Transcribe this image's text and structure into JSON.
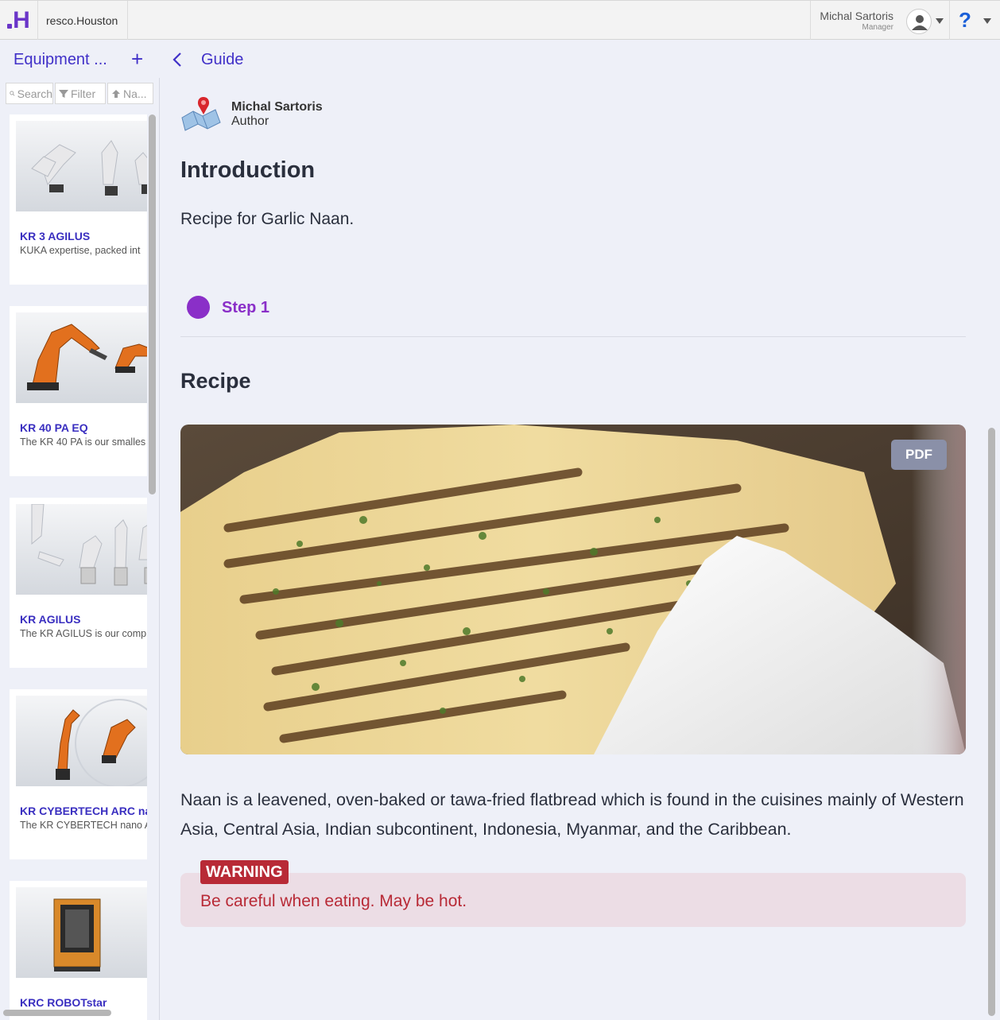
{
  "app": {
    "org": "resco.Houston",
    "colors": {
      "accent": "#4030c8",
      "logo": "#6a35c8",
      "step": "#8a2fc8",
      "warning": "#b82a36"
    }
  },
  "user": {
    "name": "Michal Sartoris",
    "role": "Manager",
    "help": "?"
  },
  "nav": {
    "title": "Equipment ...",
    "plus": "+",
    "guide": "Guide"
  },
  "sidebar": {
    "search_placeholder": "Search",
    "filter_label": "Filter",
    "sort_label": "Na...",
    "items": [
      {
        "title": "KR 3 AGILUS",
        "desc": "KUKA expertise, packed int"
      },
      {
        "title": "KR 40 PA EQ",
        "desc": "The KR 40 PA is our smalles"
      },
      {
        "title": "KR AGILUS",
        "desc": "The KR AGILUS is our comp"
      },
      {
        "title": "KR CYBERTECH ARC na",
        "desc": "The KR CYBERTECH nano AI"
      },
      {
        "title": "KRC ROBOTstar",
        "desc": ""
      }
    ]
  },
  "guide": {
    "author_name": "Michal Sartoris",
    "author_role": "Author",
    "intro_heading": "Introduction",
    "intro_text": "Recipe for Garlic Naan.",
    "step_label": "Step 1",
    "recipe_heading": "Recipe",
    "pdf_label": "PDF",
    "body": "Naan is a leavened, oven-baked or tawa-fried flatbread which is found in the cuisines mainly of Western Asia, Central Asia, Indian subcontinent, Indonesia, Myanmar, and the Caribbean.",
    "warning_label": "WARNING",
    "warning_text": "Be careful when eating. May be hot."
  }
}
